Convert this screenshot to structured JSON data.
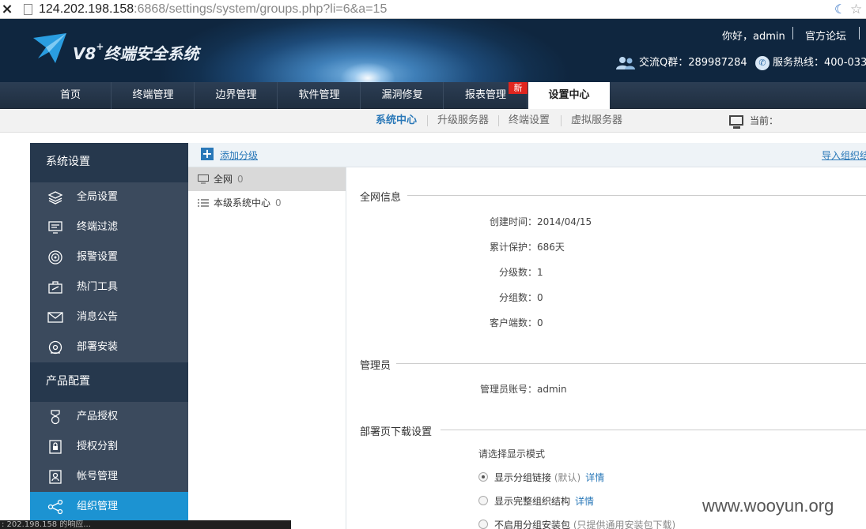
{
  "browser": {
    "close_glyph": "×",
    "url_host": "124.202.198.158",
    "url_rest": ":6868/settings/system/groups.php?li=6&a=15"
  },
  "header": {
    "brand_prefix": "V8",
    "brand_plus": "+",
    "brand_name": "终端安全系统",
    "greeting": "你好，admin",
    "forum": "官方论坛",
    "qq_group": "交流Q群：289987284",
    "hotline": "服务热线：400-033-"
  },
  "nav": {
    "items": [
      "首页",
      "终端管理",
      "边界管理",
      "软件管理",
      "漏洞修复",
      "报表管理",
      "设置中心"
    ],
    "new_badge": "新",
    "active": "设置中心"
  },
  "subnav": {
    "items": [
      "系统中心",
      "升级服务器",
      "终端设置",
      "虚拟服务器"
    ],
    "current_label": "当前："
  },
  "sidebar": {
    "section1": "系统设置",
    "items1": [
      "全局设置",
      "终端过滤",
      "报警设置",
      "热门工具",
      "消息公告",
      "部署安装"
    ],
    "section2": "产品配置",
    "items2": [
      "产品授权",
      "授权分割",
      "帐号管理",
      "组织管理"
    ]
  },
  "toolbar": {
    "add_icon": "+",
    "add_group": "添加分级",
    "import": "导入组织结"
  },
  "tree": {
    "nodes": [
      {
        "label": "全网",
        "count": "0"
      },
      {
        "label": "本级系统中心",
        "count": "0"
      }
    ]
  },
  "detail": {
    "net_info_title": "全网信息",
    "created_label": "创建时间：",
    "created_value": "2014/04/15",
    "protect_label": "累计保护：",
    "protect_value": "686天",
    "levels_label": "分级数：",
    "levels_value": "1",
    "groups_label": "分组数：",
    "groups_value": "0",
    "clients_label": "客户端数：",
    "clients_value": "0",
    "admin_title": "管理员",
    "admin_label": "管理员账号：",
    "admin_value": "admin",
    "deploy_title": "部署页下载设置",
    "mode_prompt": "请选择显示模式",
    "option1": "显示分组链接",
    "option1_note": "(默认)",
    "option1_link": "详情",
    "option2": "显示完整组织结构",
    "option2_link": "详情",
    "option3": "不启用分组安装包",
    "option3_note": "(只提供通用安装包下载)"
  },
  "status_bar": ": 202.198.158 的响应...",
  "watermark": "www.wooyun.org"
}
